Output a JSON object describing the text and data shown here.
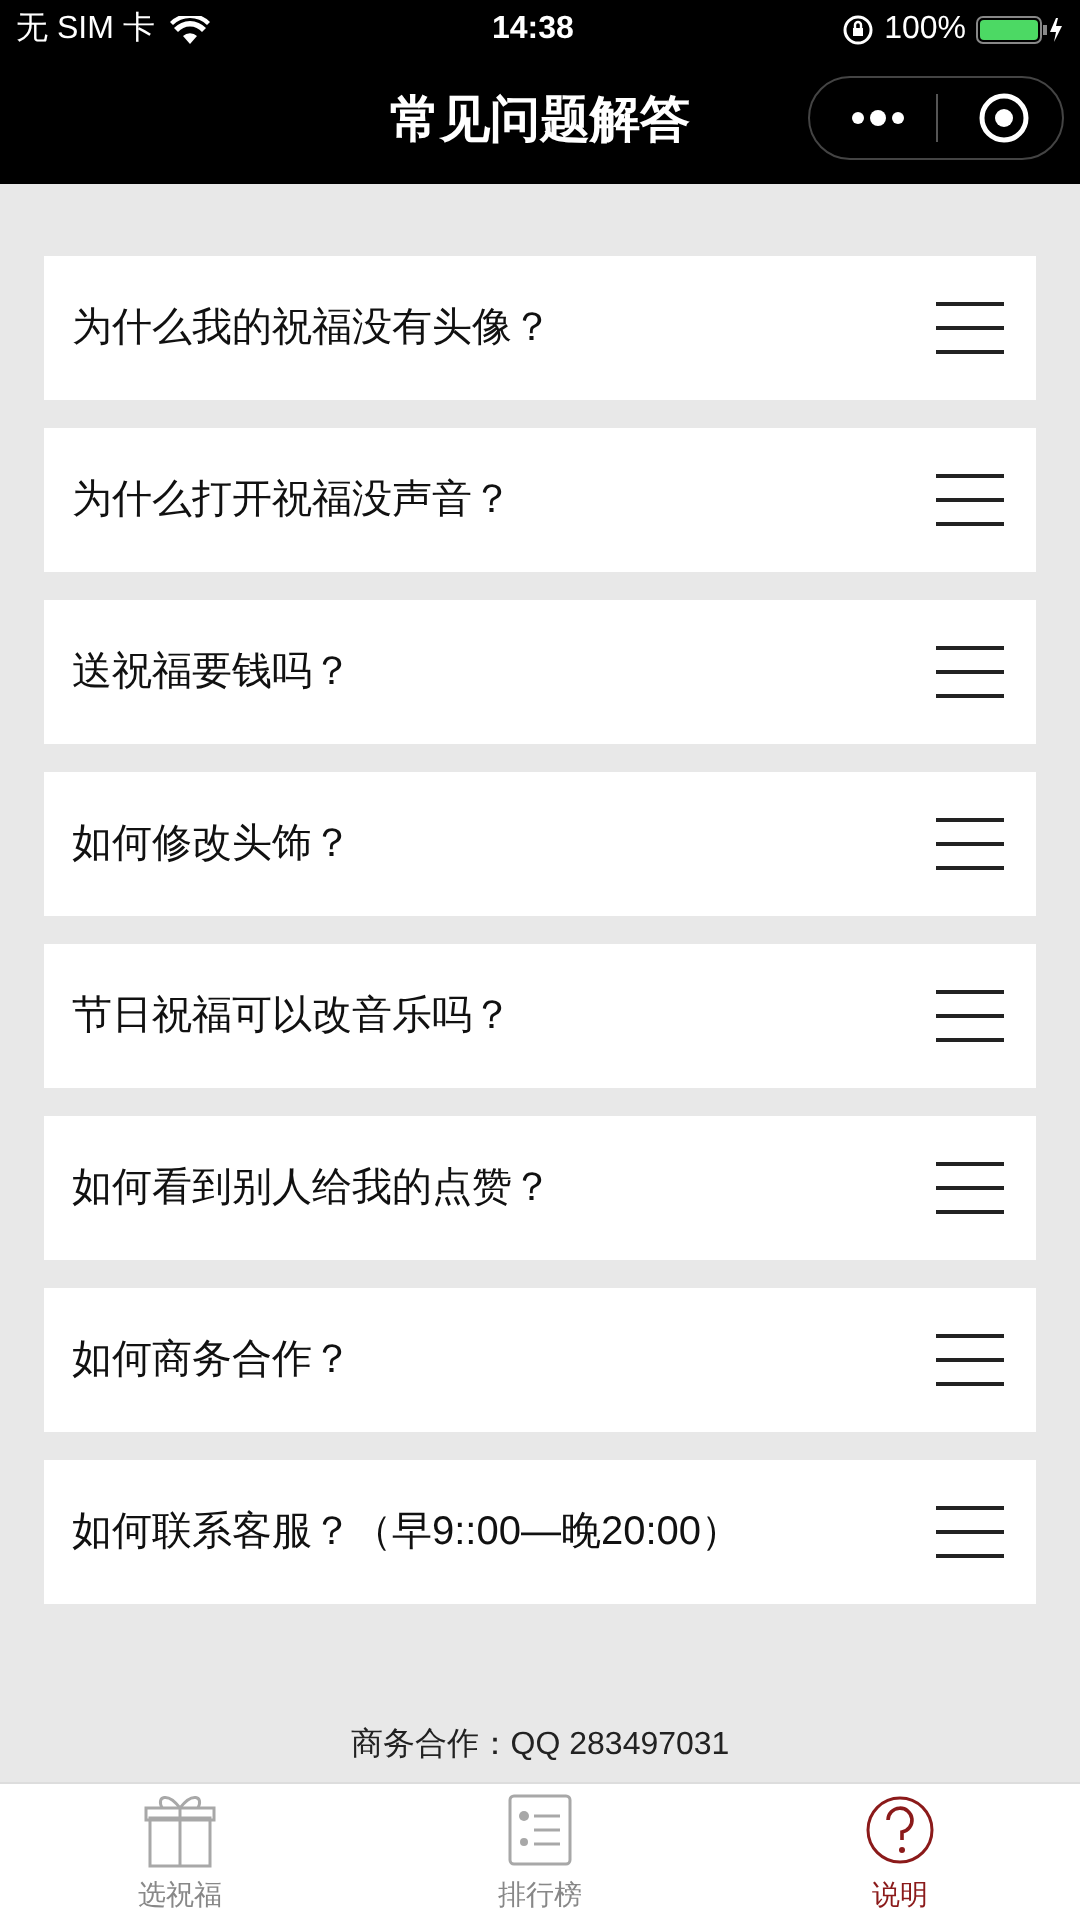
{
  "status_bar": {
    "carrier": "无 SIM 卡",
    "time": "14:38",
    "battery": "100%"
  },
  "nav_bar": {
    "title": "常见问题解答"
  },
  "faq_items": [
    {
      "question": "为什么我的祝福没有头像？"
    },
    {
      "question": "为什么打开祝福没声音？"
    },
    {
      "question": "送祝福要钱吗？"
    },
    {
      "question": "如何修改头饰？"
    },
    {
      "question": "节日祝福可以改音乐吗？"
    },
    {
      "question": "如何看到别人给我的点赞？"
    },
    {
      "question": "如何商务合作？"
    },
    {
      "question": "如何联系客服？（早9::00—晚20:00）"
    }
  ],
  "footer_note": "商务合作：QQ 283497031",
  "tab_bar": [
    {
      "label": "选祝福",
      "kind": "gift",
      "selected": false
    },
    {
      "label": "排行榜",
      "kind": "ranking",
      "selected": false
    },
    {
      "label": "说明",
      "kind": "help",
      "selected": true
    }
  ]
}
